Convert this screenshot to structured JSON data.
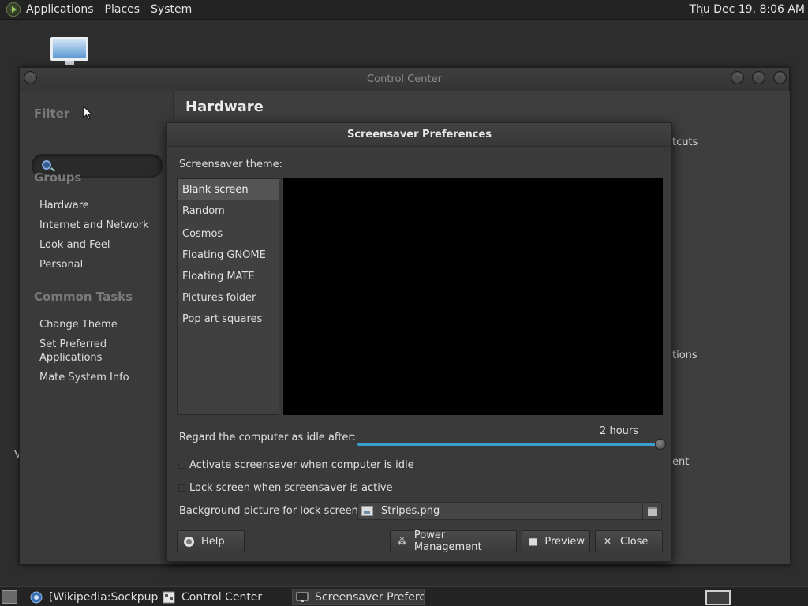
{
  "top_panel": {
    "menus": [
      "Applications",
      "Places",
      "System"
    ],
    "clock": "Thu Dec 19,  8:06 AM"
  },
  "control_center": {
    "title": "Control Center",
    "filter_heading": "Filter",
    "groups_heading": "Groups",
    "groups": [
      "Hardware",
      "Internet and Network",
      "Look and Feel",
      "Personal"
    ],
    "common_tasks_heading": "Common Tasks",
    "tasks": [
      "Change Theme",
      "Set Preferred Applications",
      "Mate System Info"
    ],
    "main_heading": "Hardware",
    "partial_labels": [
      "tcuts",
      "tions",
      "ent"
    ],
    "left_edge_fragment": "V"
  },
  "dialog": {
    "title": "Screensaver Preferences",
    "theme_label": "Screensaver theme:",
    "themes": [
      "Blank screen",
      "Random",
      "Cosmos",
      "Floating GNOME",
      "Floating MATE",
      "Pictures folder",
      "Pop art squares"
    ],
    "selected_theme_index": 0,
    "idle_label": "Regard the computer as idle after:",
    "idle_value": "2 hours",
    "idle_slider_fraction": 1.0,
    "activate_label": "Activate screensaver when computer is idle",
    "activate_checked": false,
    "lock_label": "Lock screen when screensaver is active",
    "lock_checked": false,
    "bg_label": "Background picture for lock screen:",
    "bg_file": "Stripes.png",
    "buttons": {
      "help": "Help",
      "power": "Power Management",
      "preview": "Preview",
      "close": "Close"
    }
  },
  "taskbar": {
    "tasks": [
      "[Wikipedia:Sockpup…",
      "Control Center",
      "Screensaver Prefere…"
    ]
  },
  "colors": {
    "accent": "#3c9dd0",
    "panel": "#232323",
    "window": "#3a3a3a"
  }
}
